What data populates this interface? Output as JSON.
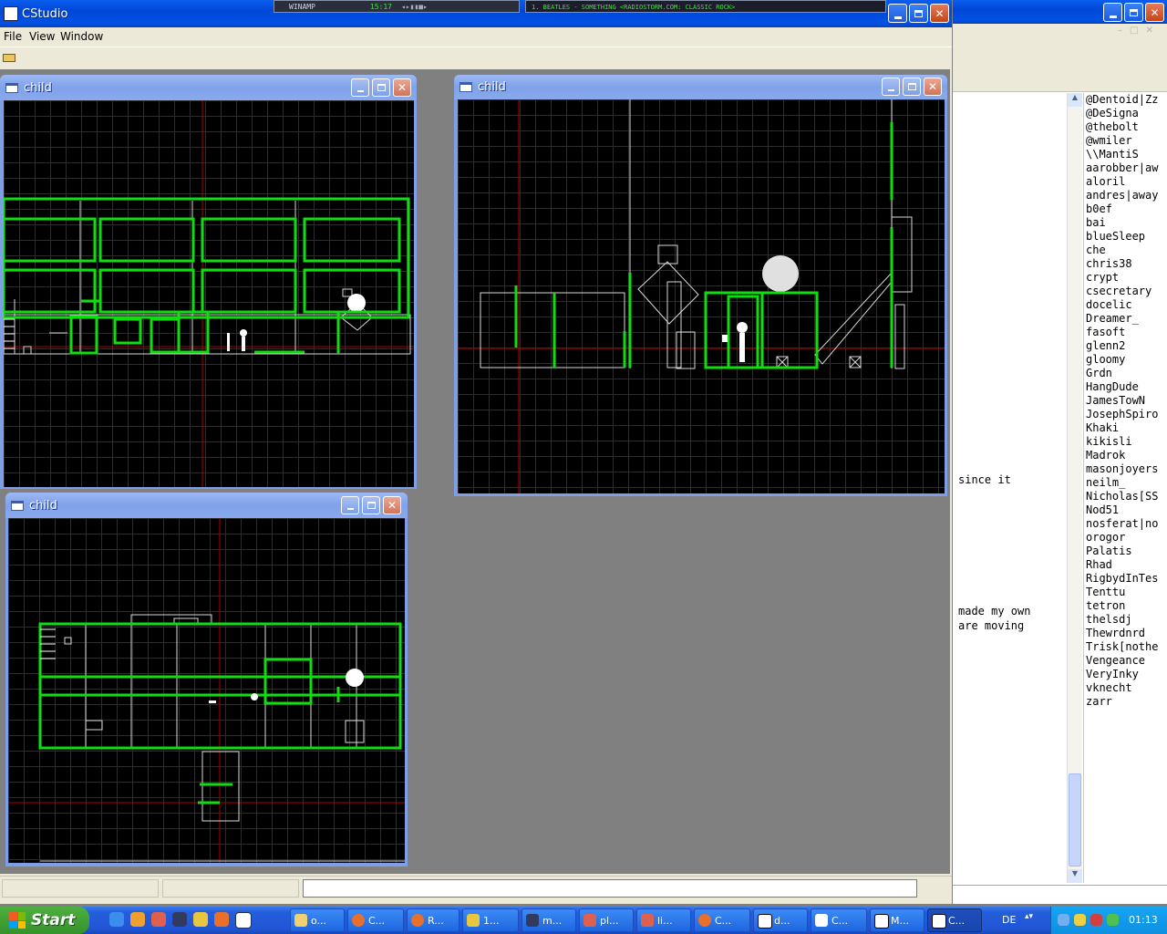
{
  "app": {
    "title": "CStudio"
  },
  "menu": [
    "File",
    "View",
    "Window"
  ],
  "winamp": {
    "label": "WINAMP",
    "time": "15:17",
    "track": "1. BEATLES - SOMETHING <RADIOSTORM.COM: CLASSIC ROCK>"
  },
  "children": [
    {
      "title": "child"
    },
    {
      "title": "child"
    },
    {
      "title": "child"
    }
  ],
  "chat": {
    "lines": [
      "since it",
      "made my own",
      "are moving"
    ],
    "nicks": [
      "@Dentoid|Zz",
      "@DeSigna",
      "@thebolt",
      "@wmiler",
      "\\\\MantiS",
      "aarobber|aw",
      "aloril",
      "andres|away",
      "b0ef",
      "bai",
      "blueSleep",
      "che",
      "chris38",
      "crypt",
      "csecretary",
      "docelic",
      "Dreamer_",
      "fasoft",
      "glenn2",
      "gloomy",
      "Grdn",
      "HangDude",
      "JamesTowN",
      "JosephSpiro",
      "Khaki",
      "kikisli",
      "Madrok",
      "masonjoyers",
      "neilm_",
      "Nicholas[SS",
      "Nod51",
      "nosferat|no",
      "orogor",
      "Palatis",
      "Rhad",
      "RigbydInTes",
      "Tenttu",
      "tetron",
      "thelsdj",
      "Thewrdnrd",
      "Trisk[nothe",
      "Vengeance",
      "VeryInky",
      "vknecht",
      "zarr"
    ]
  },
  "taskbar": {
    "start": "Start",
    "tasks": [
      "o...",
      "C...",
      "R...",
      "1...",
      "m...",
      "pl...",
      "li...",
      "C...",
      "d...",
      "C...",
      "M...",
      "C..."
    ],
    "lang": "DE",
    "clock": "01:13"
  },
  "colors": {
    "accent": "#0054e3",
    "wire_green": "#00e000",
    "axis_red": "#c00000",
    "start_green": "#3c9e32"
  }
}
